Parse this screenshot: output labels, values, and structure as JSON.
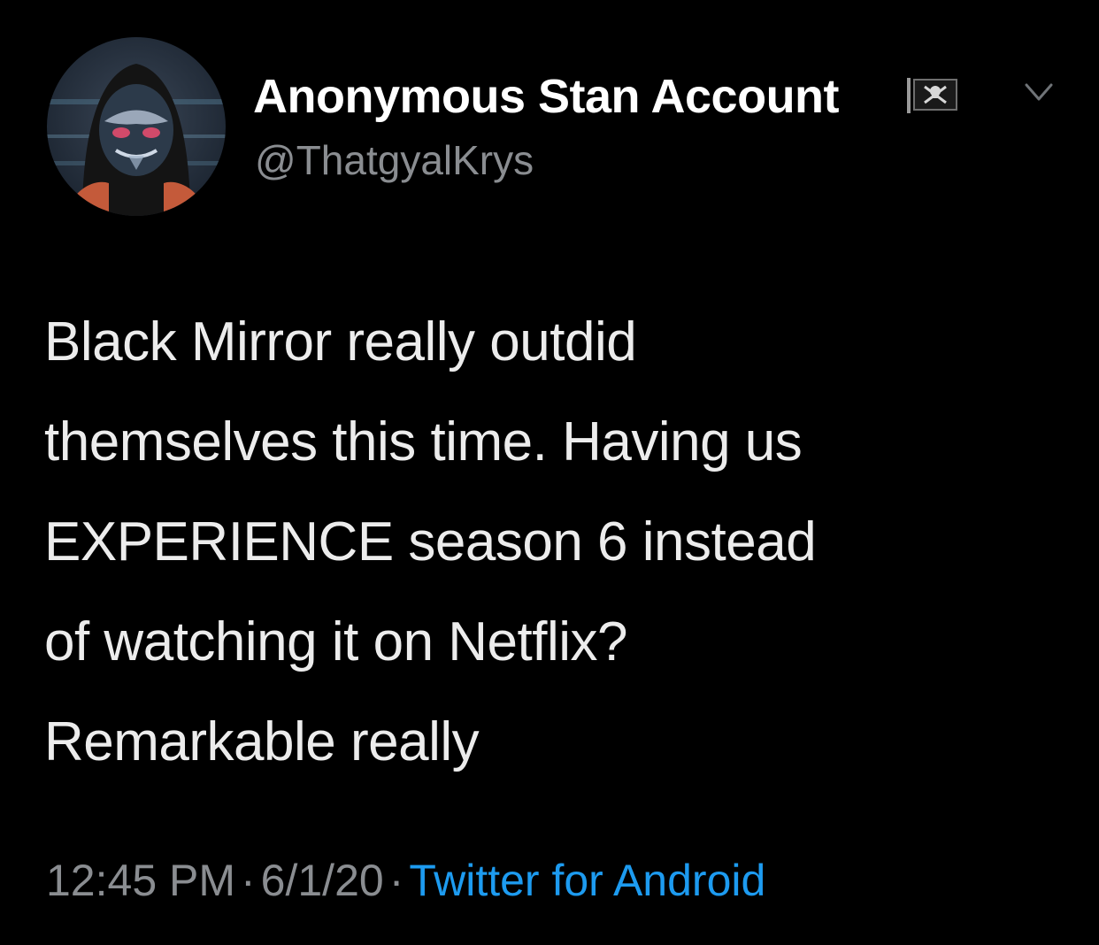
{
  "tweet": {
    "author": {
      "display_name": "Anonymous Stan Account",
      "handle": "@ThatgyalKrys",
      "flag_icon": "pirate-flag-icon"
    },
    "text_lines": [
      "Black Mirror really outdid",
      "themselves this time. Having us",
      "EXPERIENCE season 6 instead",
      "of watching it on Netflix?",
      "Remarkable really"
    ],
    "time": "12:45 PM",
    "date": "6/1/20",
    "separator": "·",
    "source": "Twitter for Android",
    "colors": {
      "background": "#000000",
      "text": "#ececec",
      "muted": "#8a8d91",
      "link": "#1d9bf0"
    }
  }
}
